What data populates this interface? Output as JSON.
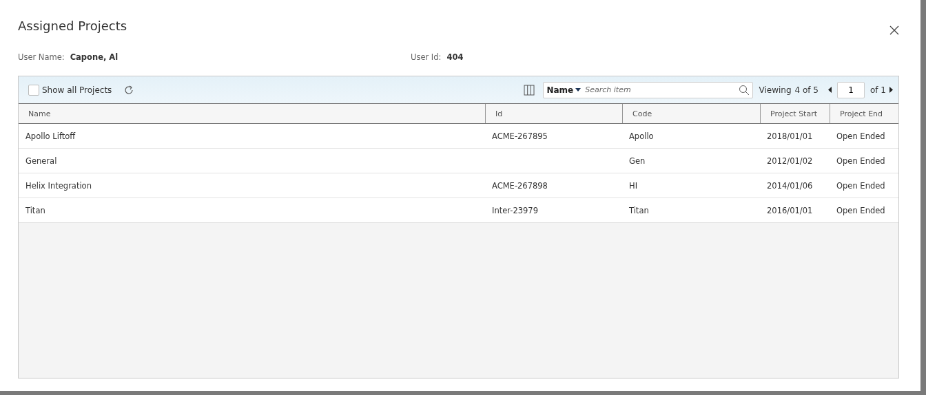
{
  "dialog": {
    "title": "Assigned Projects"
  },
  "user": {
    "name_label": "User Name:",
    "name": "Capone, Al",
    "id_label": "User Id:",
    "id": "404"
  },
  "toolbar": {
    "show_all": {
      "label": "Show all Projects",
      "checked": false
    },
    "search": {
      "field": "Name",
      "placeholder": "Search item"
    },
    "viewing_label": "Viewing",
    "viewing_count": "4 of 5",
    "page": "1",
    "page_total": "of 1"
  },
  "table": {
    "columns": [
      "Name",
      "Id",
      "Code",
      "Project Start",
      "Project End"
    ],
    "rows": [
      {
        "name": "Apollo Liftoff",
        "id": "ACME-267895",
        "code": "Apollo",
        "start": "2018/01/01",
        "end": "Open Ended"
      },
      {
        "name": "General",
        "code": "Gen",
        "start": "2012/01/02",
        "end": "Open Ended"
      },
      {
        "name": "Helix Integration",
        "id": "ACME-267898",
        "code": "HI",
        "start": "2014/01/06",
        "end": "Open Ended"
      },
      {
        "name": "Titan",
        "id": "Inter-23979",
        "code": "Titan",
        "start": "2016/01/01",
        "end": "Open Ended"
      }
    ]
  }
}
